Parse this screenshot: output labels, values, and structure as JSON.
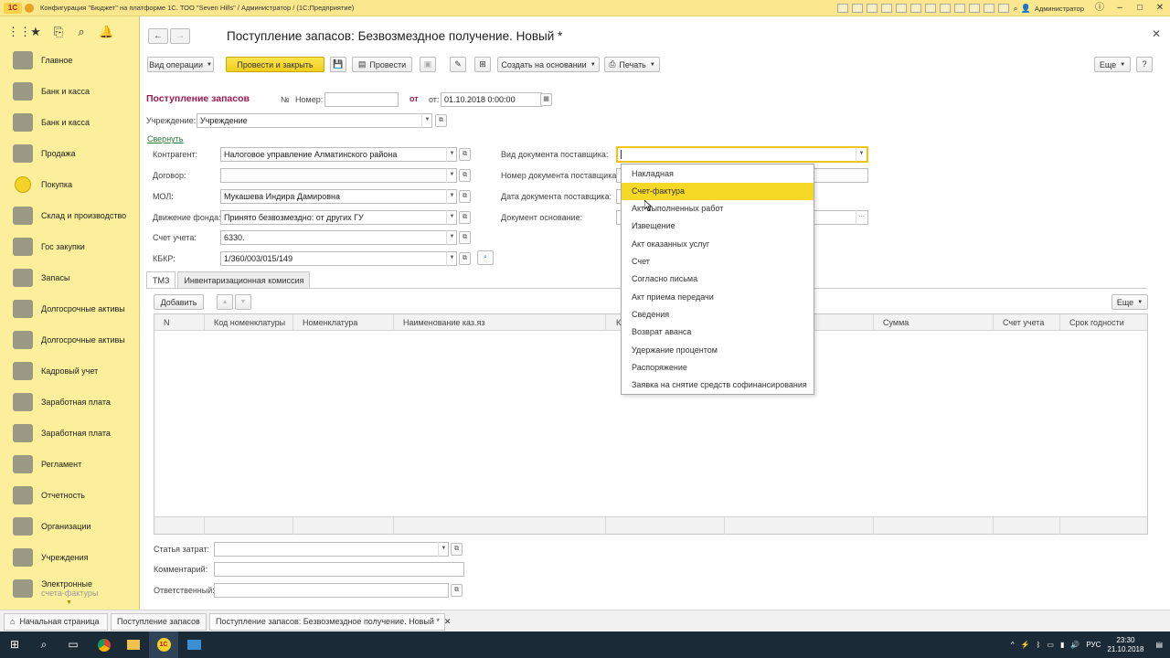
{
  "titlebar": {
    "logo": "1С",
    "title": "Конфигурация \"Бюджет\" на платформе 1С. ТОО \"Seven Hills\" / Администратор / (1С:Предприятие)",
    "user": "Администратор"
  },
  "sidebar": {
    "items": [
      {
        "label": "Главное",
        "icon": "home-icon"
      },
      {
        "label": "Банк и касса",
        "icon": "bank-icon"
      },
      {
        "label": "Банк и касса",
        "icon": "bank-icon"
      },
      {
        "label": "Продажа",
        "icon": "sales-icon"
      },
      {
        "label": "Покупка",
        "icon": "purchase-icon"
      },
      {
        "label": "Склад и производство",
        "icon": "warehouse-icon"
      },
      {
        "label": "Гос закупки",
        "icon": "gov-purchase-icon"
      },
      {
        "label": "Запасы",
        "icon": "stock-icon"
      },
      {
        "label": "Долгосрочные активы",
        "icon": "assets-icon"
      },
      {
        "label": "Долгосрочные активы",
        "icon": "assets-icon"
      },
      {
        "label": "Кадровый учет",
        "icon": "hr-icon"
      },
      {
        "label": "Заработная плата",
        "icon": "salary-icon"
      },
      {
        "label": "Заработная плата",
        "icon": "salary-icon"
      },
      {
        "label": "Регламент",
        "icon": "regulation-icon"
      },
      {
        "label": "Отчетность",
        "icon": "reports-icon"
      },
      {
        "label": "Организации",
        "icon": "organizations-icon"
      },
      {
        "label": "Учреждения",
        "icon": "institutions-icon"
      },
      {
        "label": "Электронные",
        "label2": "счета-фактуры",
        "icon": "einvoice-icon"
      }
    ]
  },
  "doc": {
    "title": "Поступление запасов: Безвозмездное получение. Новый *"
  },
  "toolbar": {
    "op_type": "Вид операции",
    "post_close": "Провести и закрыть",
    "post": "Провести",
    "create_based": "Создать на основании",
    "print": "Печать",
    "more": "Еще",
    "help": "?"
  },
  "header": {
    "section": "Поступление запасов",
    "num_sign": "№",
    "number_label": "Номер:",
    "number_value": "",
    "from": "от",
    "from_label": "от:",
    "date_value": "01.10.2018  0:00:00",
    "inst_label": "Учреждение:",
    "inst_value": "Учреждение",
    "collapse": "Свернуть"
  },
  "fields": {
    "counterparty_label": "Контрагент:",
    "counterparty": "Налоговое управление Алматинского района",
    "contract_label": "Договор:",
    "contract": "",
    "mol_label": "МОЛ:",
    "mol": "Мукашева Индира Дамировна",
    "fund_label": "Движение фонда:",
    "fund": "Принято безвозмездно: от других ГУ",
    "account_label": "Счет учета:",
    "account": "6330.",
    "kbkr_label": "КБКР:",
    "kbkr": "1/360/003/015/149",
    "supplier_doc_type_label": "Вид документа поставщика:",
    "supplier_doc_number_label": "Номер документа поставщика:",
    "supplier_doc_date_label": "Дата документа поставщика:",
    "base_doc_label": "Документ основание:"
  },
  "tabs": [
    "ТМЗ",
    "Инвентаризационная комиссия"
  ],
  "table_toolbar": {
    "add": "Добавить",
    "up": "▲",
    "down": "▼",
    "more": "Еще"
  },
  "table": {
    "columns": [
      "N",
      "Код номенклатуры",
      "Номенклатура",
      "Наименование каз.яз",
      "К",
      "Сумма",
      "Счет учета",
      "Срок годности"
    ]
  },
  "footer": {
    "expense_label": "Статья затрат:",
    "comment_label": "Комментарий:",
    "responsible_label": "Ответственный:"
  },
  "dropdown": {
    "items": [
      "Накладная",
      "Счет-фактура",
      "Акт выполненных работ",
      "Извещение",
      "Акт оказанных услуг",
      "Счет",
      "Согласно письма",
      "Акт приема передачи",
      "Сведения",
      "Возврат аванса",
      "Удержание процентом",
      "Распоряжение",
      "Заявка на снятие средств софинансирования"
    ],
    "selected_index": 1
  },
  "task_tabs": [
    "Начальная страница",
    "Поступление запасов",
    "Поступление запасов: Безвозмездное получение. Новый *"
  ],
  "taskbar": {
    "lang": "РУС",
    "time": "23:30",
    "date": "21.10.2018"
  },
  "colors": {
    "accent_yellow": "#f6d927",
    "sidebar_bg": "#fcef9b",
    "header_red": "#9c1a4d",
    "link_green": "#2a7a3c"
  }
}
